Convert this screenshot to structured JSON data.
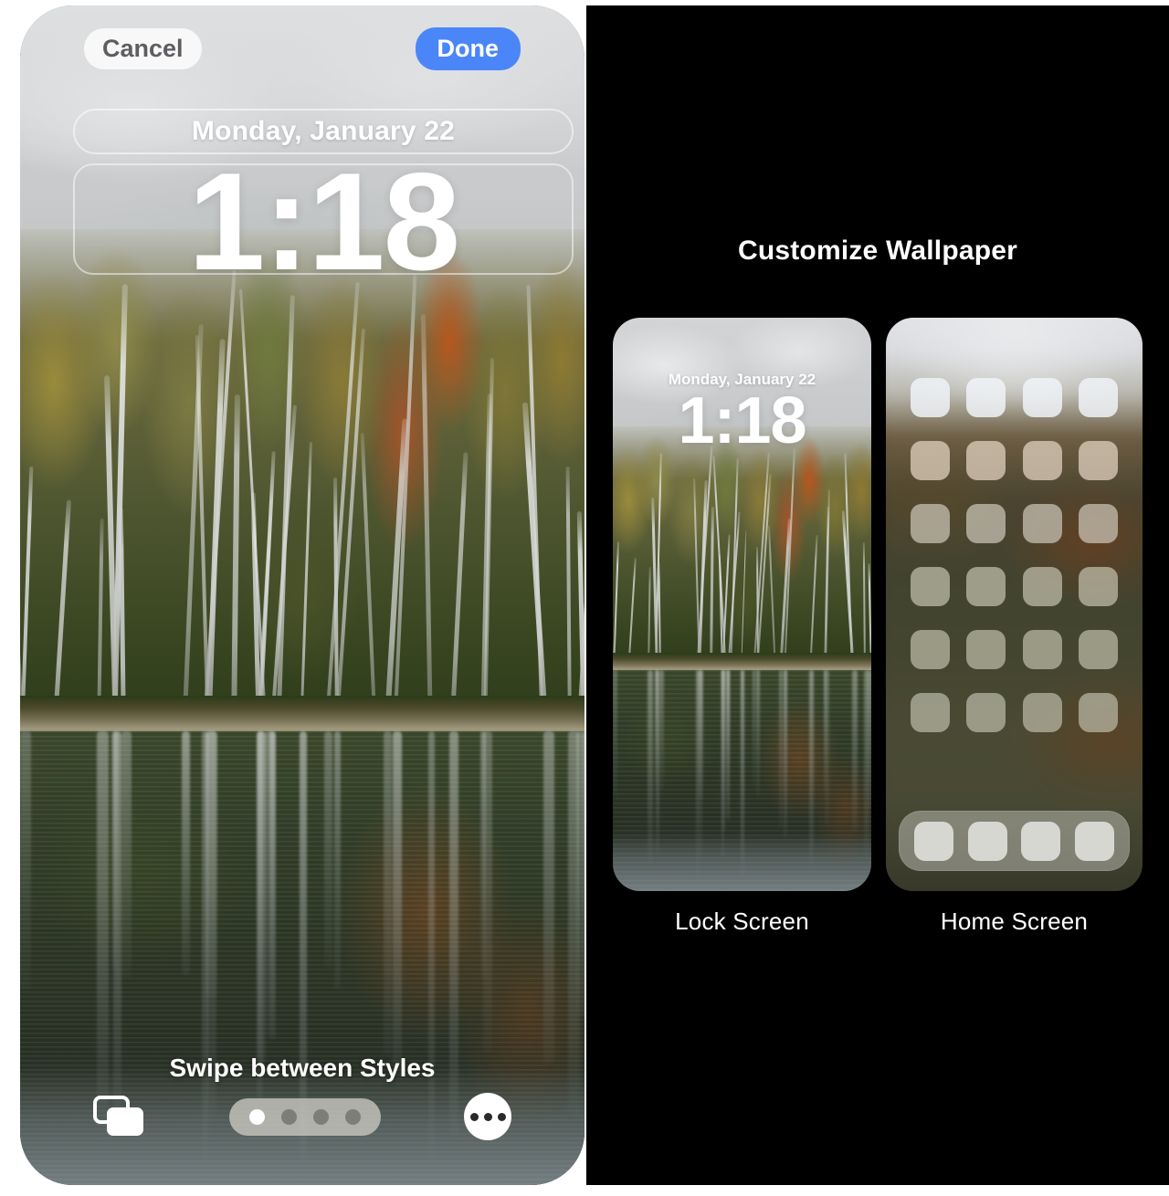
{
  "editor": {
    "cancel_label": "Cancel",
    "done_label": "Done",
    "done_color": "#4a86f7",
    "date": "Monday, January 22",
    "time": "1:18",
    "swipe_hint": "Swipe between Styles",
    "photos_icon": "photo-library-icon",
    "more_icon": "ellipsis-icon",
    "page_dots": {
      "count": 4,
      "active_index": 0
    }
  },
  "customize": {
    "title": "Customize Wallpaper",
    "previews": [
      {
        "label": "Lock Screen",
        "date": "Monday, January 22",
        "time": "1:18"
      },
      {
        "label": "Home Screen"
      }
    ],
    "home_grid": {
      "rows": 6,
      "columns": 4
    },
    "dock": {
      "icons": 4
    }
  }
}
